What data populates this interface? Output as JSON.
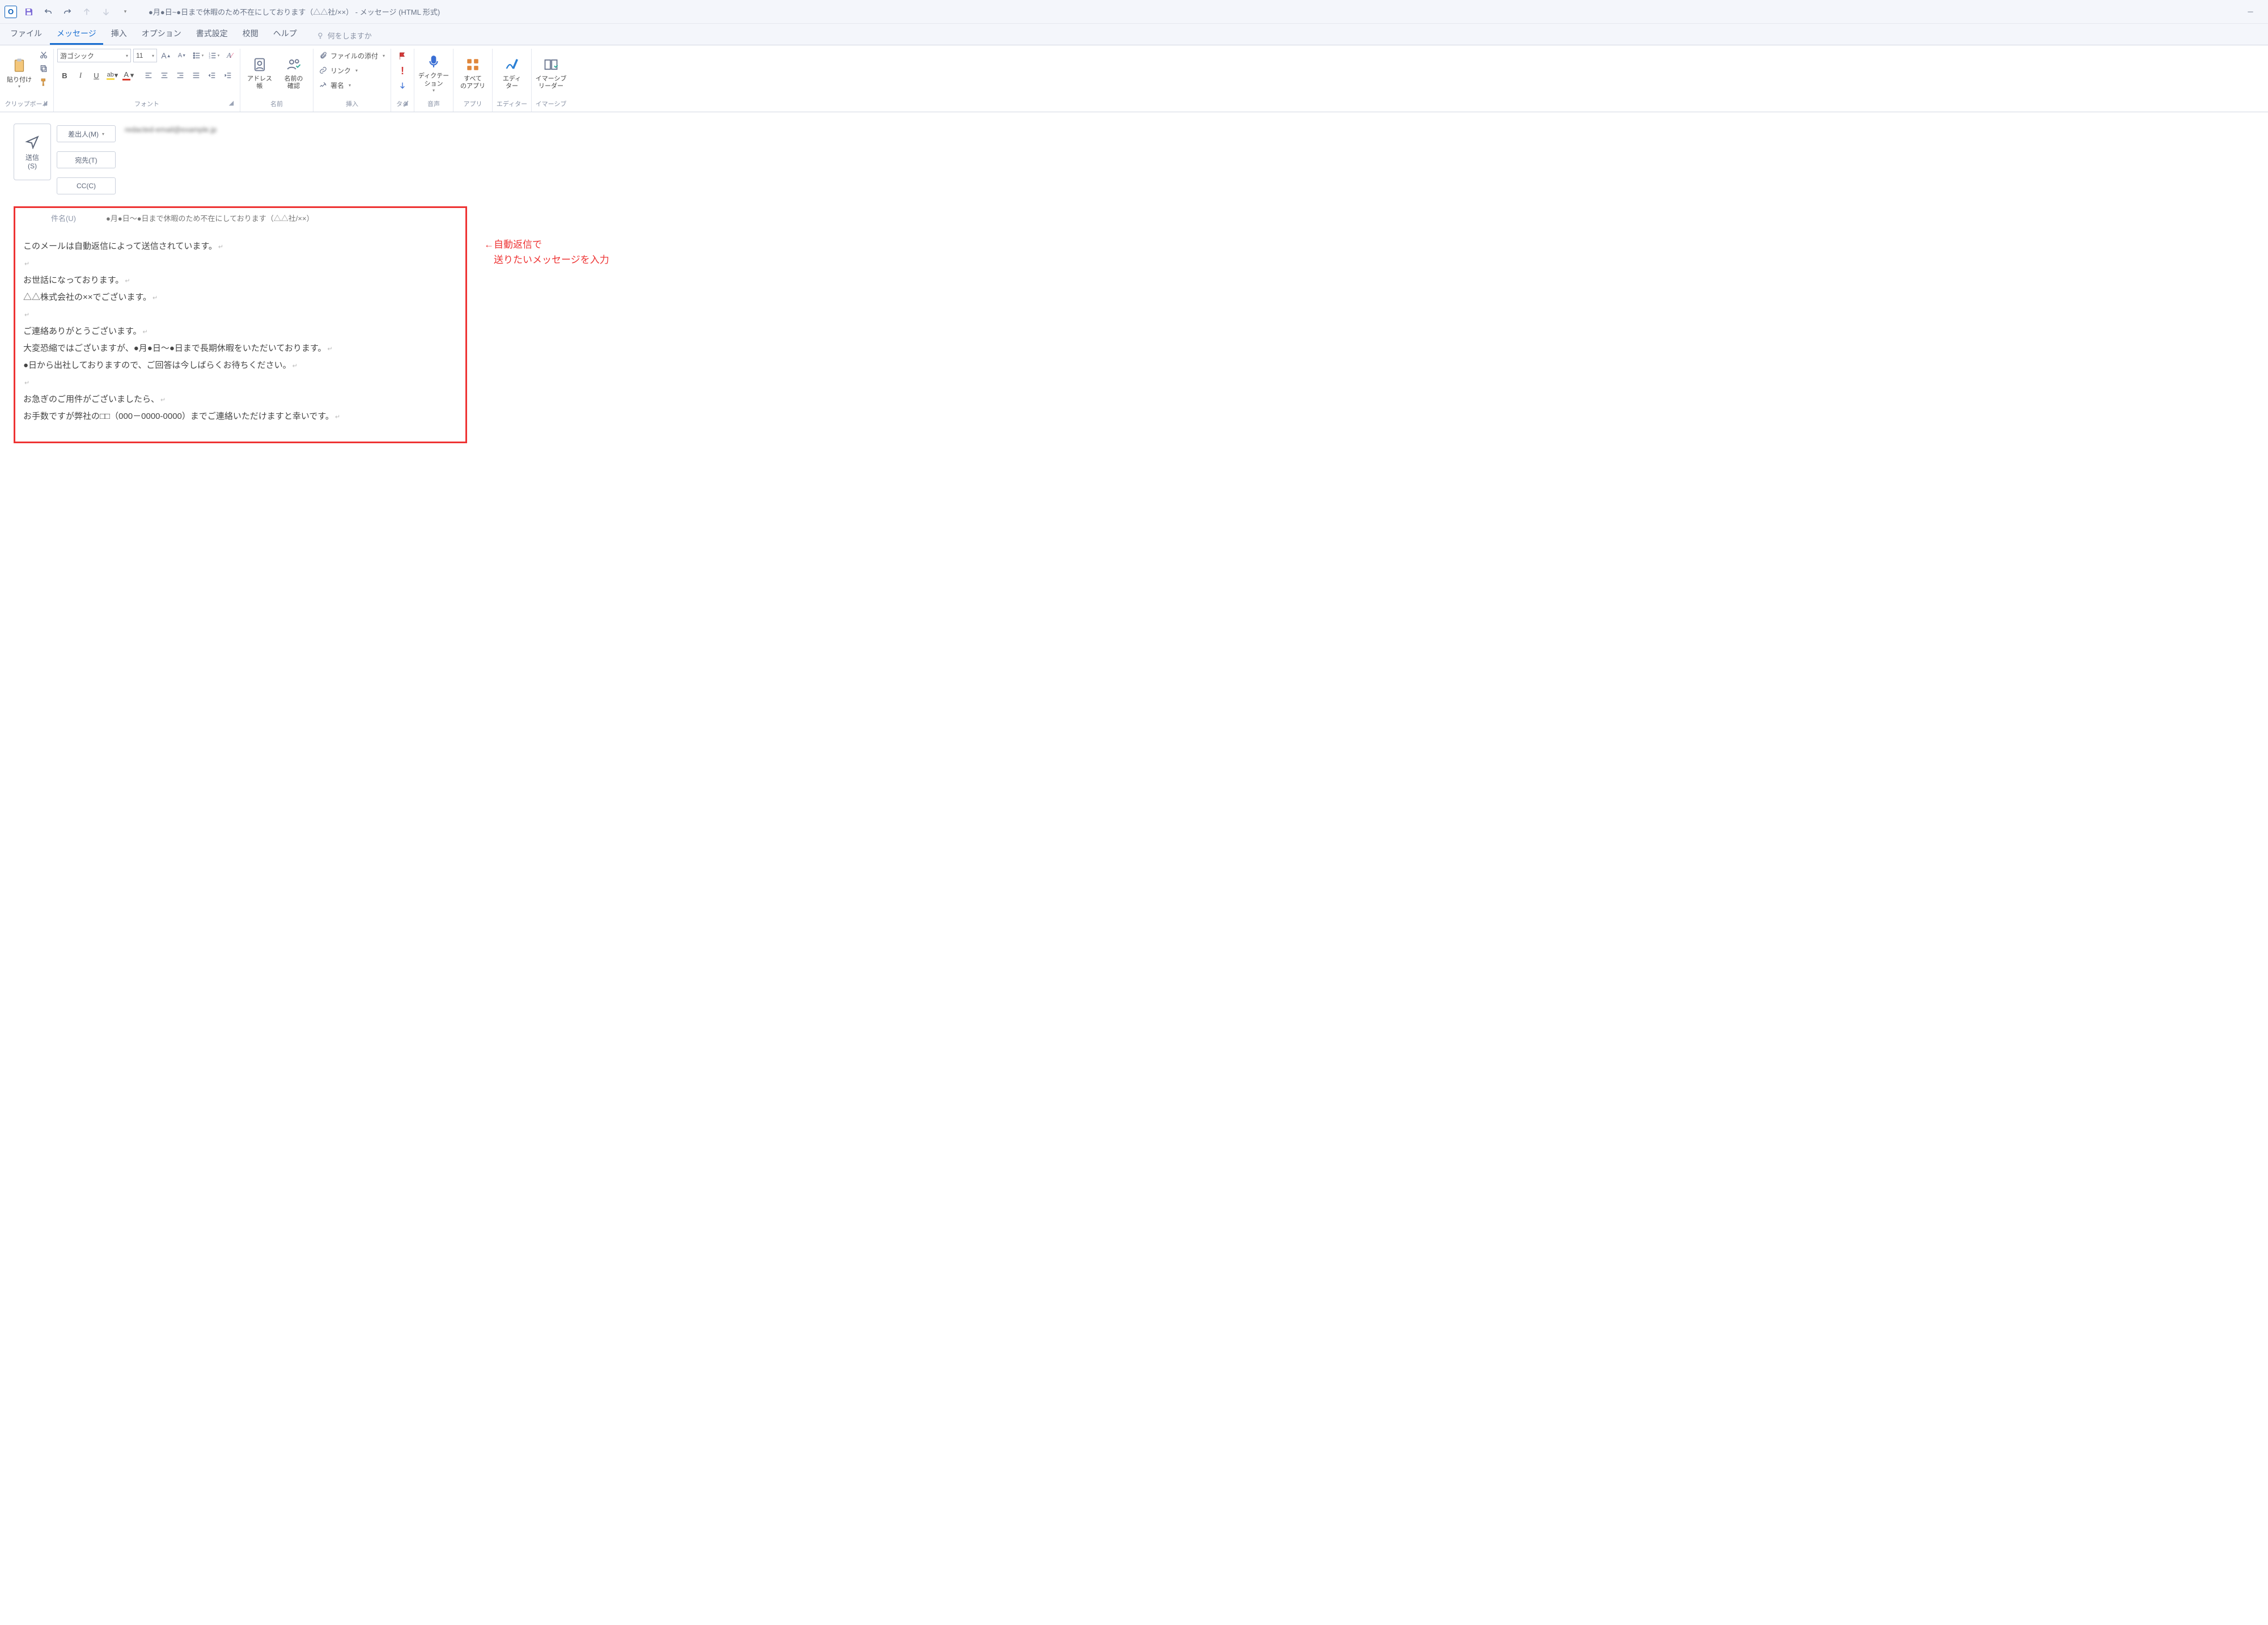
{
  "title": {
    "subject_fragment": "●月●日~●日まで休暇のため不在にしております（△△社/××）",
    "suffix": " - メッセージ (HTML 形式)"
  },
  "tabs": {
    "file": "ファイル",
    "message": "メッセージ",
    "insert": "挿入",
    "options": "オプション",
    "format": "書式設定",
    "review": "校閲",
    "help": "ヘルプ",
    "tellme": "何をしますか"
  },
  "ribbon": {
    "clipboard": {
      "label": "クリップボード",
      "paste": "貼り付け"
    },
    "font": {
      "label": "フォント",
      "name": "游ゴシック",
      "size": "11"
    },
    "names": {
      "label": "名前",
      "addressbook": "アドレス帳",
      "checknames": "名前の\n確認"
    },
    "include": {
      "label": "挿入",
      "attach": "ファイルの添付",
      "link": "リンク",
      "sign": "署名"
    },
    "tags": {
      "label": "タグ"
    },
    "voice": {
      "label": "音声",
      "dictate": "ディクテー\nション"
    },
    "apps": {
      "label": "アプリ",
      "allapps": "すべて\nのアプリ"
    },
    "editor": {
      "label": "エディター",
      "editor": "エディ\nター"
    },
    "immersive": {
      "label": "イマーシブ",
      "reader": "イマーシブ\nリーダー"
    }
  },
  "compose": {
    "send": "送信\n(S)",
    "from_btn": "差出人(M)",
    "from_value": "redacted-email@example.jp",
    "to_btn": "宛先(T)",
    "cc_btn": "CC(C)",
    "subject_label": "件名(U)",
    "subject_value": "●月●日～●日まで休暇のため不在にしております（△△社/××）",
    "body_lines": [
      "このメールは自動返信によって送信されています。",
      "",
      "お世話になっております。",
      "△△株式会社の××でございます。",
      "",
      "ご連絡ありがとうございます。",
      "大変恐縮ではございますが、●月●日～●日まで長期休暇をいただいております。",
      "●日から出社しておりますので、ご回答は今しばらくお待ちください。",
      "",
      "お急ぎのご用件がございましたら、",
      "お手数ですが弊社の□□（000－0000-0000）までご連絡いただけますと幸いです。"
    ]
  },
  "annotation": {
    "line1": "←自動返信で",
    "line2": "　送りたいメッセージを入力"
  }
}
